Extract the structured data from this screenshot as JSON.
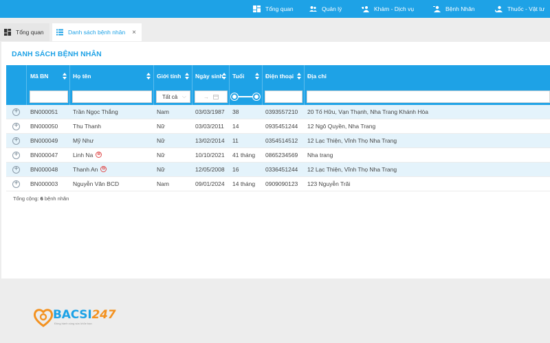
{
  "topnav": [
    {
      "label": "Tổng quan",
      "icon": "dashboard-icon"
    },
    {
      "label": "Quản lý",
      "icon": "users-icon"
    },
    {
      "label": "Khám - Dịch vụ",
      "icon": "stethoscope-icon"
    },
    {
      "label": "Bệnh Nhân",
      "icon": "patient-icon"
    },
    {
      "label": "Thuốc - Vật tư",
      "icon": "medicine-icon"
    }
  ],
  "tabs": [
    {
      "label": "Tổng quan",
      "icon": "dashboard-icon",
      "active": false
    },
    {
      "label": "Danh sách bệnh nhân",
      "icon": "list-icon",
      "active": true,
      "close": "×"
    }
  ],
  "panel": {
    "title": "DANH SÁCH BỆNH NHÂN"
  },
  "table": {
    "columns": [
      "Mã BN",
      "Họ tên",
      "Giới tính",
      "Ngày sinh",
      "Tuổi",
      "Điện thoại",
      "Địa chỉ"
    ],
    "filters": {
      "gender": "Tất cả",
      "date_sep": "→"
    },
    "rows": [
      {
        "id": "BN000051",
        "name": "Trần Ngọc Thắng",
        "gender": "Nam",
        "dob": "03/03/1987",
        "age": "38",
        "phone": "0393557210",
        "address": "20 Tố Hữu, Vạn Thạnh, Nha Trang Khánh Hòa",
        "badge": ""
      },
      {
        "id": "BN000050",
        "name": "Thu Thanh",
        "gender": "Nữ",
        "dob": "03/03/2011",
        "age": "14",
        "phone": "0935451244",
        "address": "12 Ngô Quyền, Nha Trang",
        "badge": ""
      },
      {
        "id": "BN000049",
        "name": "Mỹ Như",
        "gender": "Nữ",
        "dob": "13/02/2014",
        "age": "11",
        "phone": "0354514512",
        "address": "12 Lạc Thiện, Vĩnh Thọ Nha Trang",
        "badge": ""
      },
      {
        "id": "BN000047",
        "name": "Linh Na",
        "gender": "Nữ",
        "dob": "10/10/2021",
        "age": "41 tháng",
        "phone": "0865234569",
        "address": "Nha trang",
        "badge": "B"
      },
      {
        "id": "BN000048",
        "name": "Thanh An",
        "gender": "Nữ",
        "dob": "12/05/2008",
        "age": "16",
        "phone": "0336451244",
        "address": "12 Lạc Thiện, Vĩnh Thọ Nha Trang",
        "badge": "B"
      },
      {
        "id": "BN000003",
        "name": "Nguyễn Văn BCD",
        "gender": "Nam",
        "dob": "09/01/2024",
        "age": "14 tháng",
        "phone": "0909090123",
        "address": "123 Nguyễn Trãi",
        "badge": ""
      }
    ]
  },
  "footer": {
    "prefix": "Tổng cộng:",
    "count": "6",
    "suffix": "bệnh nhân"
  },
  "logo": {
    "word_main": "BACSI",
    "word_num": "247",
    "tagline": "Đồng hành cùng sức khỏe bạn"
  },
  "colors": {
    "accent": "#1ea2e6",
    "row_alt": "#e4f3fb",
    "logo_orange": "#f39221",
    "badge_red": "#e04b4b"
  }
}
